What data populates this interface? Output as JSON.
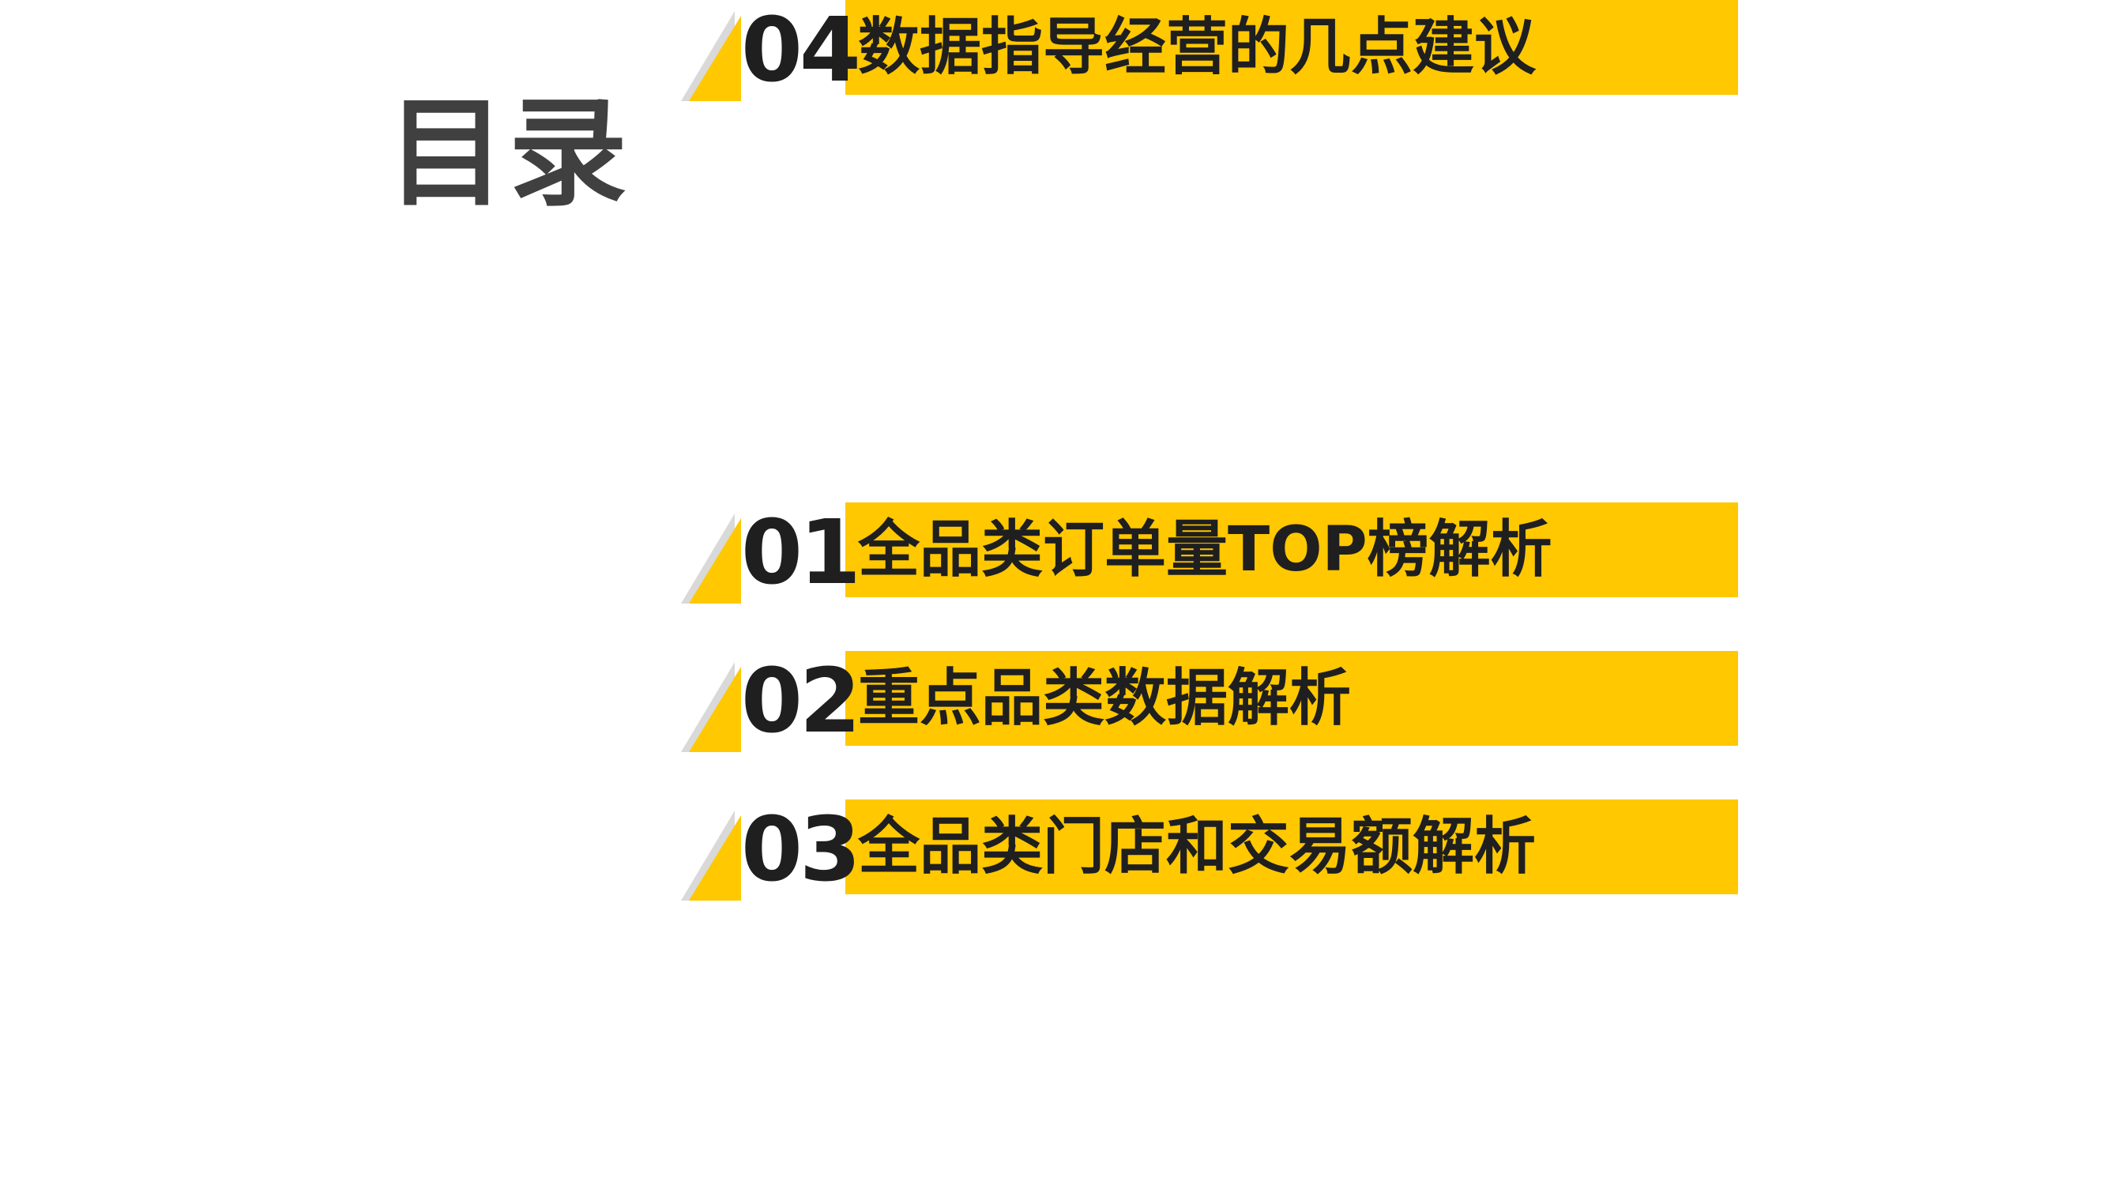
{
  "title": "目录",
  "items": [
    {
      "number": "01",
      "label": "全品类订单量TOP榜解析"
    },
    {
      "number": "02",
      "label": "重点品类数据解析"
    },
    {
      "number": "03",
      "label": "全品类门店和交易额解析"
    },
    {
      "number": "04",
      "label": "数据指导经营的几点建议"
    }
  ],
  "colors": {
    "accent": "#FFC800",
    "title": "#404040",
    "text": "#1f1f1f",
    "shadow": "#D9D9D9"
  }
}
